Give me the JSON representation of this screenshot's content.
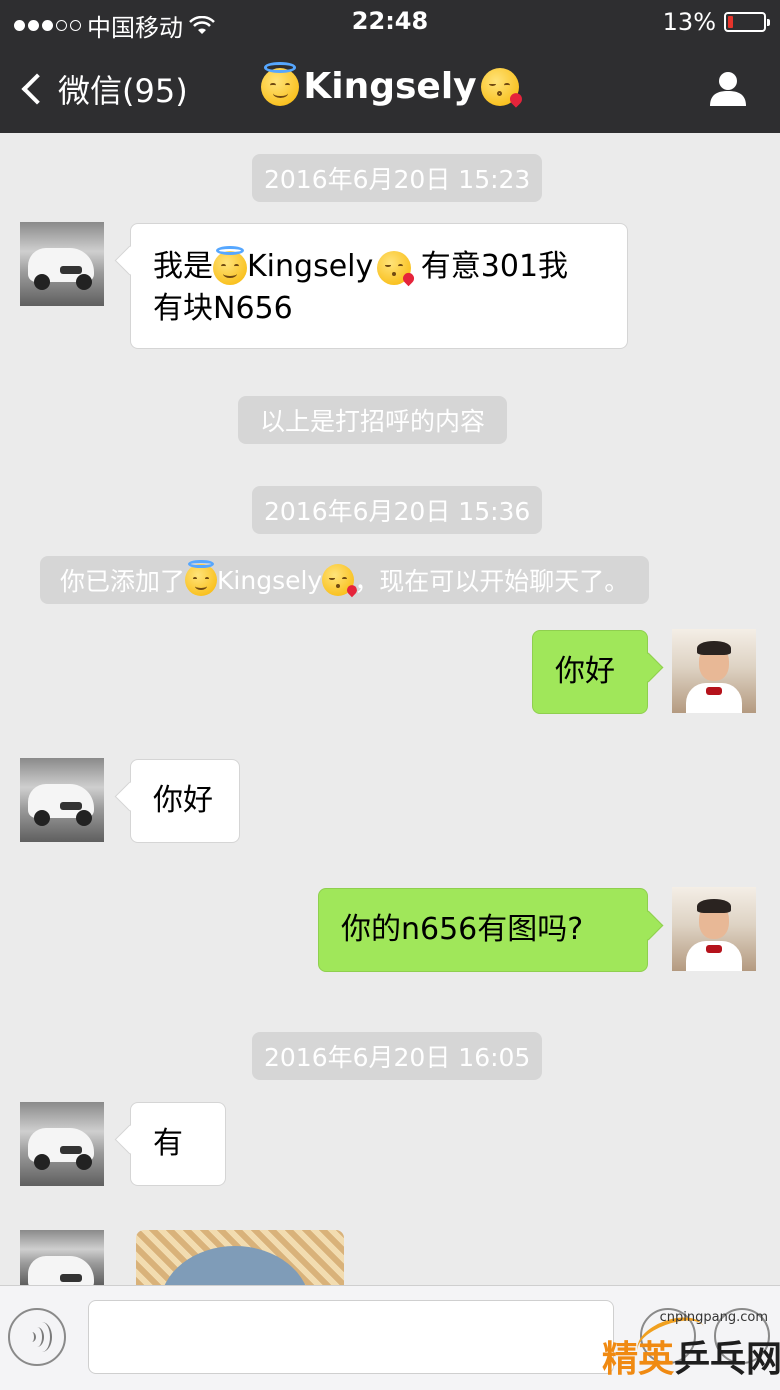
{
  "status_bar": {
    "carrier": "中国移动",
    "time": "22:48",
    "battery": "13%",
    "battery_level": 0.13,
    "signal_bars_filled": 3,
    "signal_bars_total": 5
  },
  "nav": {
    "back_label": "微信(95)",
    "title": "Kingsely",
    "title_emoji_left": "halo-smile-emoji",
    "title_emoji_right": "kiss-heart-emoji",
    "profile_icon": "person-icon"
  },
  "chat": {
    "timestamps": [
      "2016年6月20日 15:23",
      "2016年6月20日 15:36",
      "2016年6月20日 16:05"
    ],
    "greeting": {
      "line1_prefix": "我是",
      "name": "Kingsely",
      "line1_suffix": " 有意301我",
      "line2": "有块N656"
    },
    "system_greeting_note": "以上是打招呼的内容",
    "system_added": {
      "prefix": "你已添加了",
      "name": "Kingsely",
      "suffix": "，现在可以开始聊天了。"
    },
    "messages": [
      {
        "side": "right",
        "text": "你好"
      },
      {
        "side": "left",
        "text": "你好"
      },
      {
        "side": "right",
        "text": "你的n656有图吗?"
      },
      {
        "side": "left",
        "text": "有"
      }
    ]
  },
  "input_bar": {
    "voice_icon": "voice-icon",
    "emoji_icon": "emoji-icon",
    "plus_icon": "plus-icon"
  },
  "watermark": {
    "url": "cnpingpang.com",
    "text_a": "精英",
    "text_b": "乒乓网"
  },
  "colors": {
    "nav_bg": "#2e2e30",
    "chat_bg": "#ebebeb",
    "my_bubble": "#a0e75a",
    "their_bubble": "#ffffff",
    "timestamp_bg": "#d6d6d6"
  }
}
